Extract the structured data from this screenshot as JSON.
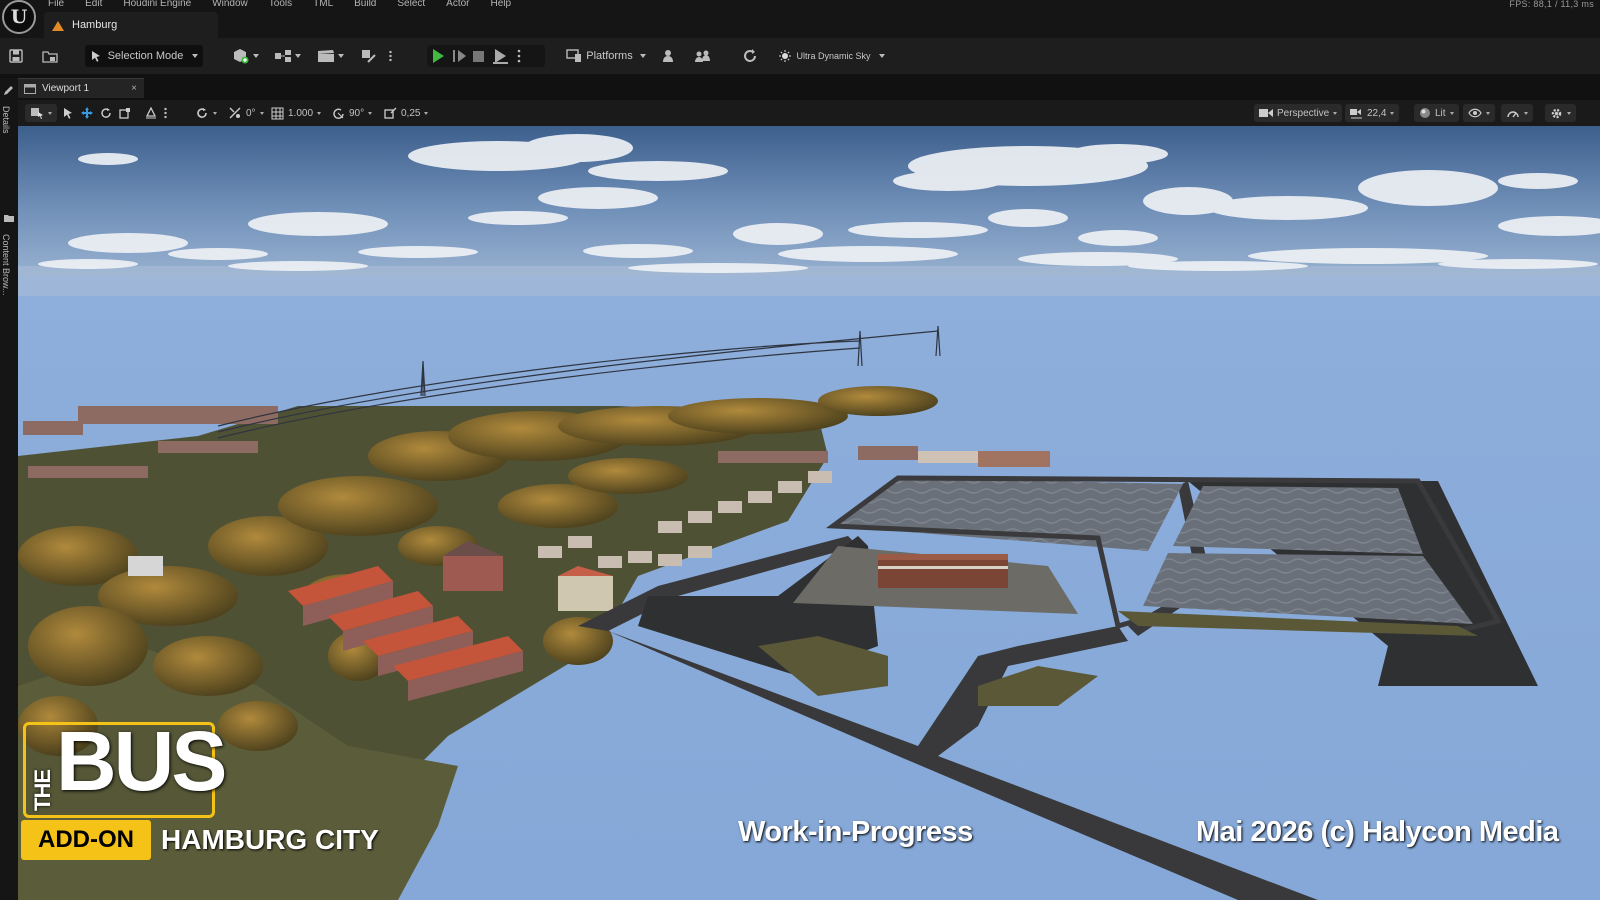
{
  "menubar": {
    "items": [
      "File",
      "Edit",
      "Houdini Engine",
      "Window",
      "Tools",
      "TML",
      "Build",
      "Select",
      "Actor",
      "Help"
    ],
    "project_tab": "Hamburg",
    "fps_readout": "FPS: 88,1  /  11,3 ms"
  },
  "toolbar": {
    "selection_mode": "Selection Mode",
    "platforms": "Platforms",
    "sky": "Ultra Dynamic Sky",
    "accent_play": "#3fb93f"
  },
  "viewport": {
    "tab_label": "Viewport 1",
    "tab_close": "×",
    "rotate_snap": "0°",
    "scale_value": "1.000",
    "angle_snap": "90°",
    "scale_snap": "0,25",
    "perspective": "Perspective",
    "camera_speed": "22,4",
    "lit": "Lit"
  },
  "side_rail": {
    "details": "Details",
    "content_browser": "Content Brow..."
  },
  "overlay": {
    "the": "THE",
    "bus": "BUS",
    "addon": "ADD-ON",
    "city": "HAMBURG CITY",
    "wip": "Work-in-Progress",
    "copyright": "Mai 2026  (c) Halycon Media",
    "accent": "#f5c218"
  }
}
